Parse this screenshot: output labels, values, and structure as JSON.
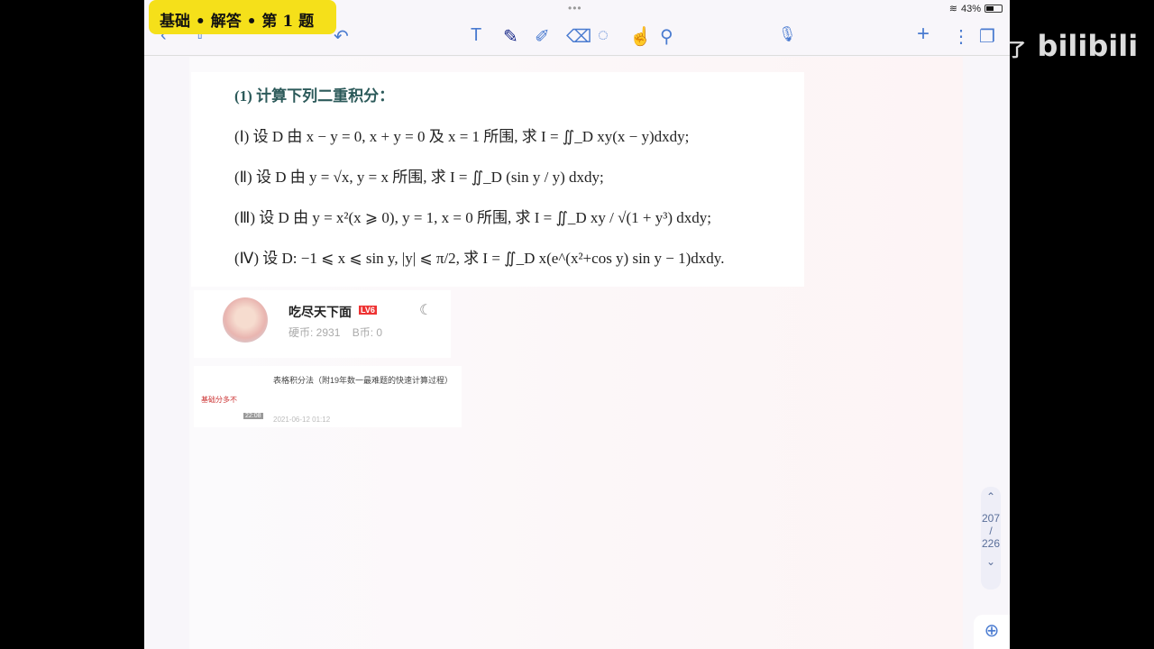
{
  "status": {
    "battery": "43%",
    "battery_level": 0.43
  },
  "banner": {
    "title": "基础 • 解答 • 第 1 题"
  },
  "toolbar": {
    "back": "‹",
    "share": "⇧",
    "undo": "↶",
    "tools": [
      {
        "name": "text-tool",
        "glyph": "T"
      },
      {
        "name": "pen-tool",
        "glyph": "✎"
      },
      {
        "name": "highlighter-tool",
        "glyph": "✐"
      },
      {
        "name": "eraser-tool",
        "glyph": "⌫"
      },
      {
        "name": "lasso-tool",
        "glyph": "◌"
      },
      {
        "name": "hand-tool",
        "glyph": "☝"
      },
      {
        "name": "shape-tool",
        "glyph": "⚲"
      }
    ],
    "mic": "🎙",
    "add": "+",
    "more": "⋮",
    "pages": "❐"
  },
  "problem": {
    "heading": "(1) 计算下列二重积分：",
    "items": [
      "(Ⅰ) 设 D 由 x − y = 0, x + y = 0 及 x = 1 所围, 求 I = ∬_D xy(x − y)dxdy;",
      "(Ⅱ) 设 D 由 y = √x, y = x 所围, 求 I = ∬_D (sin y / y) dxdy;",
      "(Ⅲ) 设 D 由 y = x²(x ⩾ 0), y = 1, x = 0 所围, 求 I = ∬_D xy / √(1 + y³) dxdy;",
      "(Ⅳ) 设 D: −1 ⩽ x ⩽ sin y, |y| ⩽ π/2, 求 I = ∬_D x(e^(x²+cos y) sin y − 1)dxdy."
    ]
  },
  "user": {
    "name": "吃尽天下面",
    "level": "LV6",
    "coins": "硬币: 2931",
    "bcoins": "B币: 0"
  },
  "video": {
    "title": "表格积分法（附19年数一最难题的快速计算过程）",
    "thumb_text": "基础分多不",
    "duration": "22:08",
    "date": "2021-06-12 01:12"
  },
  "pager": {
    "current": "207",
    "total": "226"
  },
  "watermark": {
    "partial": "了",
    "logo": "bilibili"
  }
}
